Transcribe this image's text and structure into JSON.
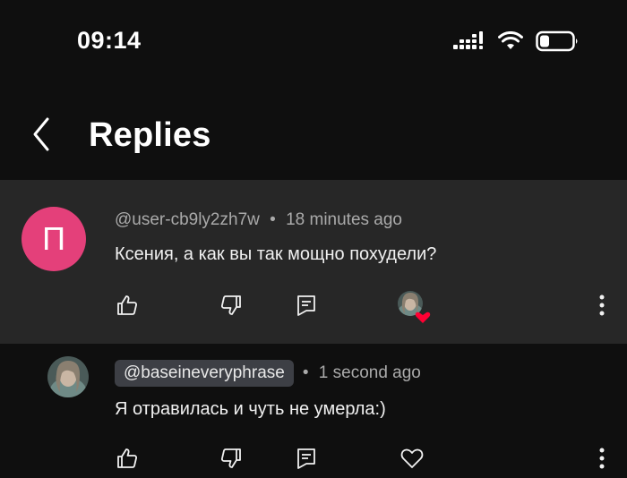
{
  "status_bar": {
    "time": "09:14",
    "icons": [
      "cellular-signal-icon",
      "wifi-icon",
      "battery-icon"
    ]
  },
  "header": {
    "title": "Replies",
    "back_icon": "chevron-left-icon"
  },
  "comment": {
    "avatar_letter": "П",
    "avatar_color": "#e4407a",
    "author": "@user-cb9ly2zh7w",
    "time": "18 minutes ago",
    "text": "Ксения, а как вы так мощно похудели?"
  },
  "reply": {
    "author": "@baseineveryphrase",
    "time": "1 second ago",
    "text": "Я отравилась и чуть не умерла:)"
  },
  "separator": "•",
  "colors": {
    "background": "#0f0f0f",
    "highlight_background": "#272727",
    "chip_background": "#3d3f45",
    "heart_red": "#ff0033"
  }
}
